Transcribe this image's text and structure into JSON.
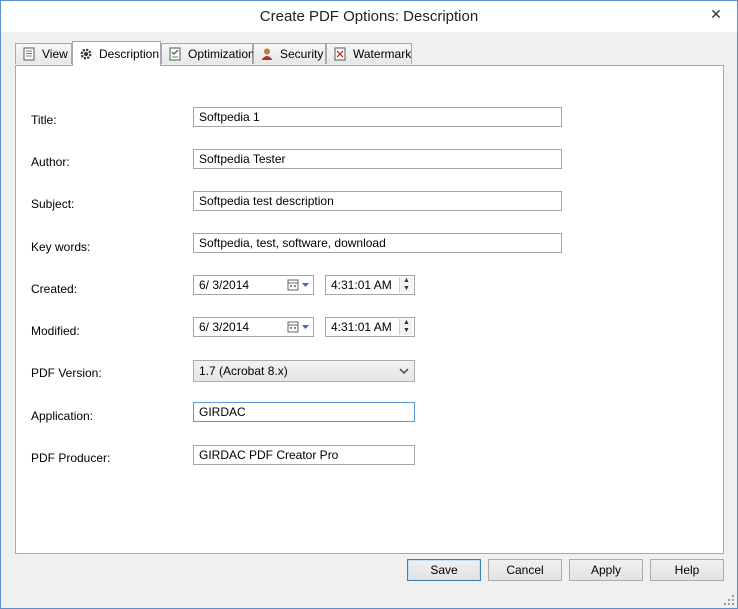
{
  "window": {
    "title": "Create PDF Options: Description",
    "close_glyph": "✕"
  },
  "tabs": [
    {
      "label": "View",
      "icon": "document-icon"
    },
    {
      "label": "Description",
      "icon": "gear-icon"
    },
    {
      "label": "Optimization",
      "icon": "checklist-icon"
    },
    {
      "label": "Security",
      "icon": "user-lock-icon"
    },
    {
      "label": "Watermark",
      "icon": "watermark-icon"
    }
  ],
  "form": {
    "title_label": "Title:",
    "title_value": "Softpedia 1",
    "author_label": "Author:",
    "author_value": "Softpedia Tester",
    "subject_label": "Subject:",
    "subject_value": "Softpedia test description",
    "keywords_label": "Key words:",
    "keywords_value": "Softpedia, test, software, download",
    "created_label": "Created:",
    "created_date": "6/  3/2014",
    "created_time": "4:31:01 AM",
    "modified_label": "Modified:",
    "modified_date": "6/  3/2014",
    "modified_time": "4:31:01 AM",
    "pdf_version_label": "PDF Version:",
    "pdf_version_value": "1.7 (Acrobat 8.x)",
    "application_label": "Application:",
    "application_value": "GIRDAC",
    "producer_label": "PDF Producer:",
    "producer_value": "GIRDAC PDF Creator Pro"
  },
  "buttons": {
    "save": "Save",
    "cancel": "Cancel",
    "apply": "Apply",
    "help": "Help"
  },
  "colors": {
    "accent": "#5b9bd5",
    "default_button_border": "#3c7fb1"
  }
}
